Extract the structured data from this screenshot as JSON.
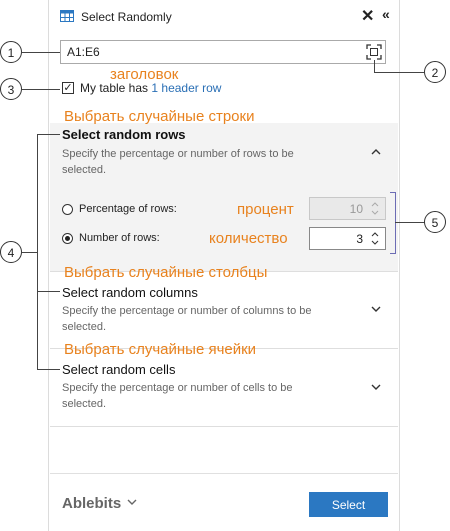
{
  "pane": {
    "title": "Select Randomly",
    "close_glyph": "✕",
    "collapse_glyph": "«"
  },
  "range": {
    "value": "A1:E6"
  },
  "header": {
    "text": "My table has",
    "link": "1 header row",
    "checked": true
  },
  "callouts": [
    "1",
    "2",
    "3",
    "4",
    "5"
  ],
  "annotations": {
    "header": "заголовок",
    "rows": "Выбрать случайные строки",
    "columns": "Выбрать случайные столбцы",
    "cells": "Выбрать случайные ячейки",
    "percentage": "процент",
    "number": "количество"
  },
  "sections": {
    "rows": {
      "title": "Select random rows",
      "desc": "Specify the percentage or number of rows to be selected."
    },
    "columns": {
      "title": "Select random columns",
      "desc": "Specify the percentage or number of columns to be selected."
    },
    "cells": {
      "title": "Select random cells",
      "desc": "Specify the percentage or number of cells to be selected."
    }
  },
  "options": {
    "percentage_label": "Percentage of rows:",
    "percentage_value": "10",
    "number_label": "Number of rows:",
    "number_value": "3",
    "selected": "number"
  },
  "footer": {
    "brand": "Ablebits",
    "select_label": "Select"
  },
  "colors": {
    "accent": "#2b78c2",
    "annotation": "#e8821e",
    "bracket": "#6c6cb4"
  }
}
